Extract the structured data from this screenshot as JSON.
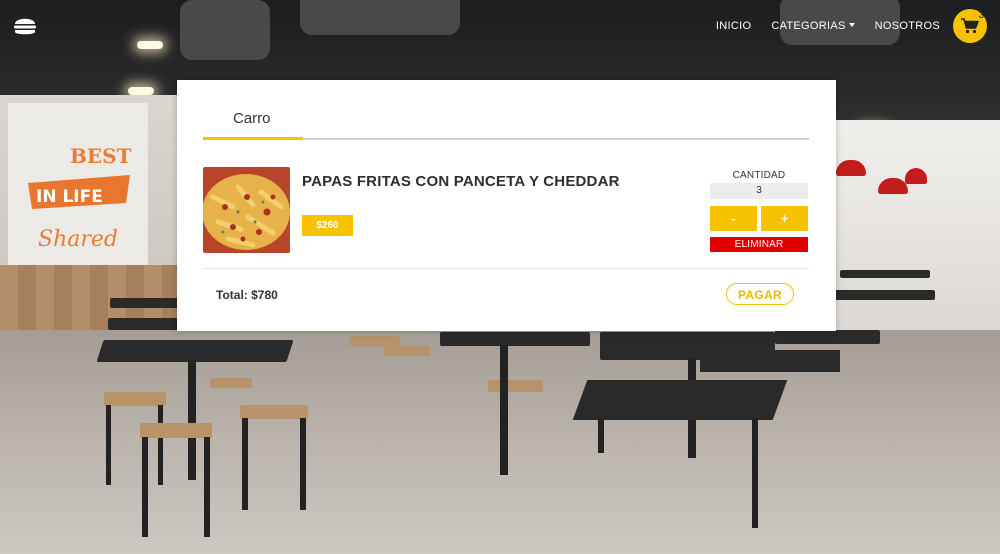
{
  "brand": {
    "logo_icon": "burger-icon"
  },
  "nav": {
    "items": [
      "INICIO",
      "CATEGORIAS",
      "NOSOTROS"
    ],
    "cart_count": "3",
    "cart_icon": "shopping-cart-icon"
  },
  "modal": {
    "tab_label": "Carro",
    "item": {
      "name": "PAPAS FRITAS CON PANCETA Y CHEDDAR",
      "price": "$260",
      "quantity_label": "CANTIDAD",
      "quantity": "3",
      "minus_label": "-",
      "plus_label": "+",
      "delete_label": "ELIMINAR"
    },
    "total": "Total: $780",
    "pay_label": "PAGAR"
  },
  "colors": {
    "accent": "#f7c300",
    "danger": "#e00000"
  }
}
